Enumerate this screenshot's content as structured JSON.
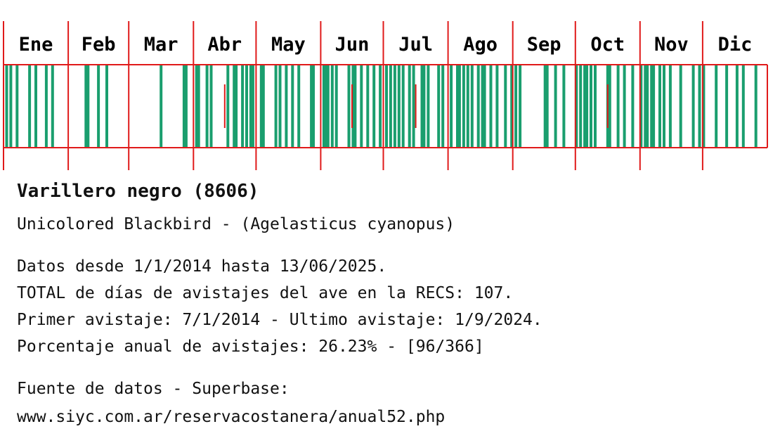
{
  "chart_data": {
    "type": "heatmap",
    "months": [
      "Ene",
      "Feb",
      "Mar",
      "Abr",
      "May",
      "Jun",
      "Jul",
      "Ago",
      "Sep",
      "Oct",
      "Nov",
      "Dic"
    ],
    "days_in_month": [
      31,
      29,
      31,
      30,
      31,
      30,
      31,
      31,
      30,
      31,
      30,
      31
    ],
    "sighting_days": [
      [
        2,
        4,
        7,
        13,
        16,
        21,
        24
      ],
      [
        9,
        10,
        15,
        19
      ],
      [
        16,
        27,
        28
      ],
      [
        2,
        3,
        7,
        9,
        17,
        20,
        21,
        24,
        26,
        28,
        29
      ],
      [
        3,
        4,
        10,
        12,
        15,
        18,
        21,
        27,
        28
      ],
      [
        2,
        3,
        4,
        6,
        8,
        14,
        16,
        17,
        20,
        23,
        26,
        29
      ],
      [
        2,
        4,
        6,
        8,
        10,
        13,
        15,
        19,
        20,
        22,
        27,
        29
      ],
      [
        2,
        5,
        6,
        8,
        10,
        12,
        15,
        17,
        18,
        21,
        24,
        28,
        31
      ],
      [
        2,
        4,
        16,
        17,
        21,
        25
      ],
      [
        1,
        3,
        5,
        6,
        8,
        10,
        16,
        17,
        21,
        24,
        28
      ],
      [
        1,
        3,
        4,
        6,
        7,
        10,
        12,
        15,
        20,
        26,
        29
      ],
      [
        1,
        7,
        12,
        17,
        20,
        26
      ]
    ],
    "bar_color": "#1a9e6e",
    "grid_color": "#e01a1a"
  },
  "info": {
    "title": "Varillero negro (8606)",
    "subtitle": "Unicolored Blackbird - (Agelasticus cyanopus)",
    "line1": "Datos desde 1/1/2014 hasta 13/06/2025.",
    "line2": "TOTAL de días de avistajes del ave en la RECS: 107.",
    "line3": "Primer avistaje: 7/1/2014 - Ultimo avistaje: 1/9/2024.",
    "line4": "Porcentaje anual de avistajes: 26.23% - [96/366]",
    "line5": "Fuente de datos - Superbase:",
    "line6": "www.siyc.com.ar/reservacostanera/anual52.php"
  }
}
